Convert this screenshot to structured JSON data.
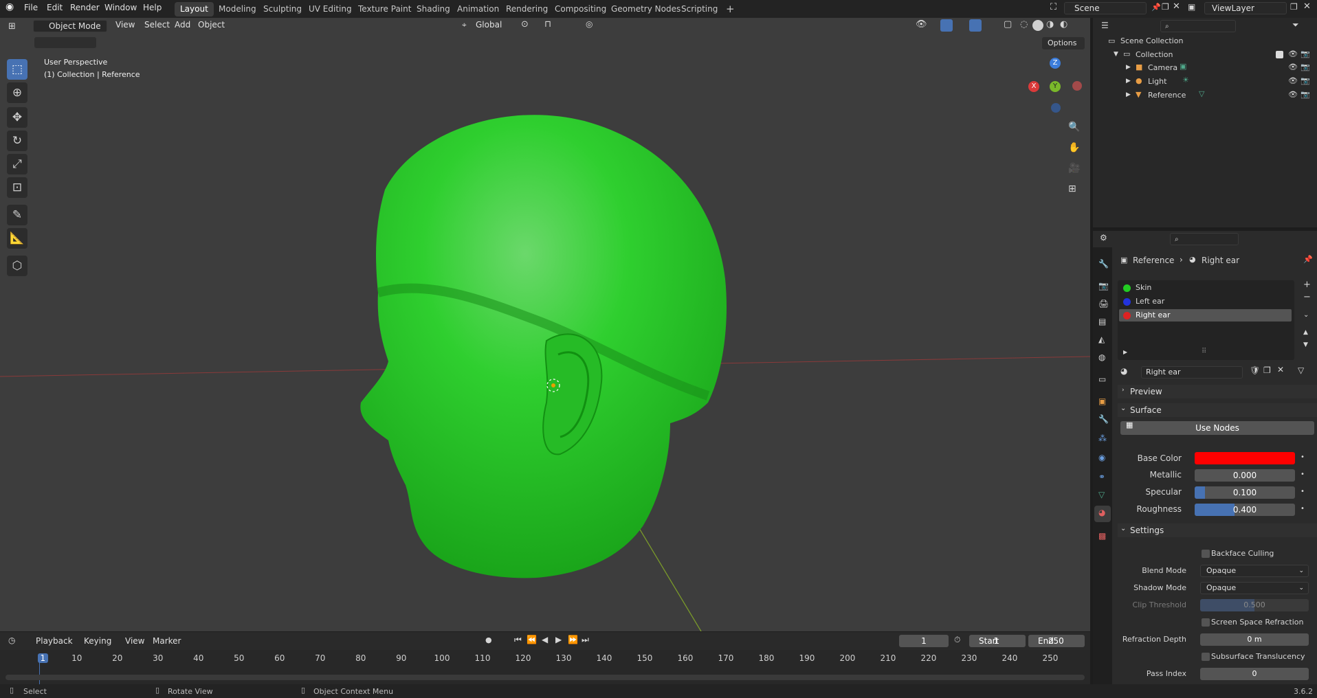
{
  "menu": {
    "file": "File",
    "edit": "Edit",
    "render": "Render",
    "window": "Window",
    "help": "Help"
  },
  "workspaces": [
    "Layout",
    "Modeling",
    "Sculpting",
    "UV Editing",
    "Texture Paint",
    "Shading",
    "Animation",
    "Rendering",
    "Compositing",
    "Geometry Nodes",
    "Scripting"
  ],
  "topright": {
    "scene": "Scene",
    "view_layer": "ViewLayer"
  },
  "viewport": {
    "mode": "Object Mode",
    "view": "View",
    "select": "Select",
    "add": "Add",
    "object": "Object",
    "orientation": "Global",
    "options": "Options",
    "perspective": "User Perspective",
    "collection_info": "(1) Collection | Reference",
    "gizmo": {
      "z": "Z",
      "y": "Y",
      "x": "X"
    }
  },
  "outliner": {
    "scene_collection": "Scene Collection",
    "collection": "Collection",
    "items": [
      {
        "label": "Camera"
      },
      {
        "label": "Light"
      },
      {
        "label": "Reference"
      }
    ]
  },
  "properties": {
    "breadcrumb_object": "Reference",
    "breadcrumb_material": "Right ear",
    "slots": [
      {
        "label": "Skin",
        "color": "#22cc22"
      },
      {
        "label": "Left ear",
        "color": "#2233dd"
      },
      {
        "label": "Right ear",
        "color": "#dd2222"
      }
    ],
    "material_name": "Right ear",
    "preview": "Preview",
    "surface": "Surface",
    "use_nodes": "Use Nodes",
    "base_color_label": "Base Color",
    "base_color": "#ff0000",
    "metallic_label": "Metallic",
    "metallic": "0.000",
    "metallic_fraction": 0.0,
    "specular_label": "Specular",
    "specular": "0.100",
    "specular_fraction": 0.1,
    "roughness_label": "Roughness",
    "roughness": "0.400",
    "roughness_fraction": 0.4,
    "settings": "Settings",
    "backface_culling": "Backface Culling",
    "blend_mode_label": "Blend Mode",
    "blend_mode": "Opaque",
    "shadow_mode_label": "Shadow Mode",
    "shadow_mode": "Opaque",
    "clip_threshold_label": "Clip Threshold",
    "clip_threshold": "0.500",
    "ssr": "Screen Space Refraction",
    "refraction_depth_label": "Refraction Depth",
    "refraction_depth": "0 m",
    "sss": "Subsurface Translucency",
    "pass_index_label": "Pass Index",
    "pass_index": "0"
  },
  "timeline": {
    "playback": "Playback",
    "keying": "Keying",
    "view": "View",
    "marker": "Marker",
    "current_frame": "1",
    "start_label": "Start",
    "start": "1",
    "end_label": "End",
    "end": "250",
    "ticks": [
      "1",
      "10",
      "20",
      "30",
      "40",
      "50",
      "60",
      "70",
      "80",
      "90",
      "100",
      "110",
      "120",
      "130",
      "140",
      "150",
      "160",
      "170",
      "180",
      "190",
      "200",
      "210",
      "220",
      "230",
      "240",
      "250"
    ]
  },
  "status": {
    "select": "Select",
    "rotate": "Rotate View",
    "context": "Object Context Menu",
    "version": "3.6.2"
  }
}
